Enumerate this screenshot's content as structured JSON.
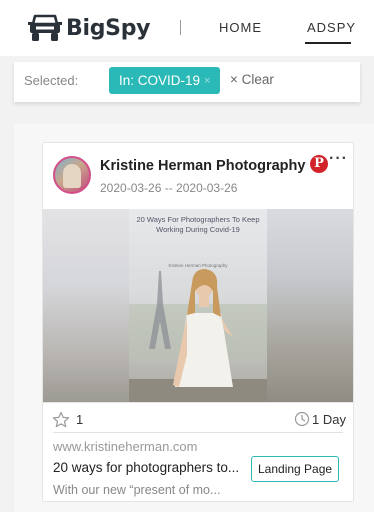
{
  "brand": {
    "name": "BigSpy",
    "logo_icon": "jeep-icon"
  },
  "nav": {
    "home": "HOME",
    "adspy": "ADSPY"
  },
  "filter": {
    "selected_label": "Selected:",
    "chip_label": "In: COVID-19",
    "chip_remove": "×",
    "clear_label": "× Clear"
  },
  "ad": {
    "advertiser": "Kristine Herman Photography",
    "date_range": "2020-03-26 -- 2020-03-26",
    "platform_icon": "pinterest-icon",
    "more": "···",
    "creative": {
      "headline": "20 Ways For Photographers To Keep Working During Covid-19",
      "credit": "Kristine Herman Photography"
    },
    "likes": "1",
    "duration": "1 Day",
    "domain": "www.kristineherman.com",
    "title": "20 ways for photographers to...",
    "cta": "Landing Page",
    "body": "With our new “present of mo..."
  },
  "colors": {
    "accent": "#2ab9b7",
    "pinterest": "#d2232a",
    "brand_text": "#2a3139"
  }
}
